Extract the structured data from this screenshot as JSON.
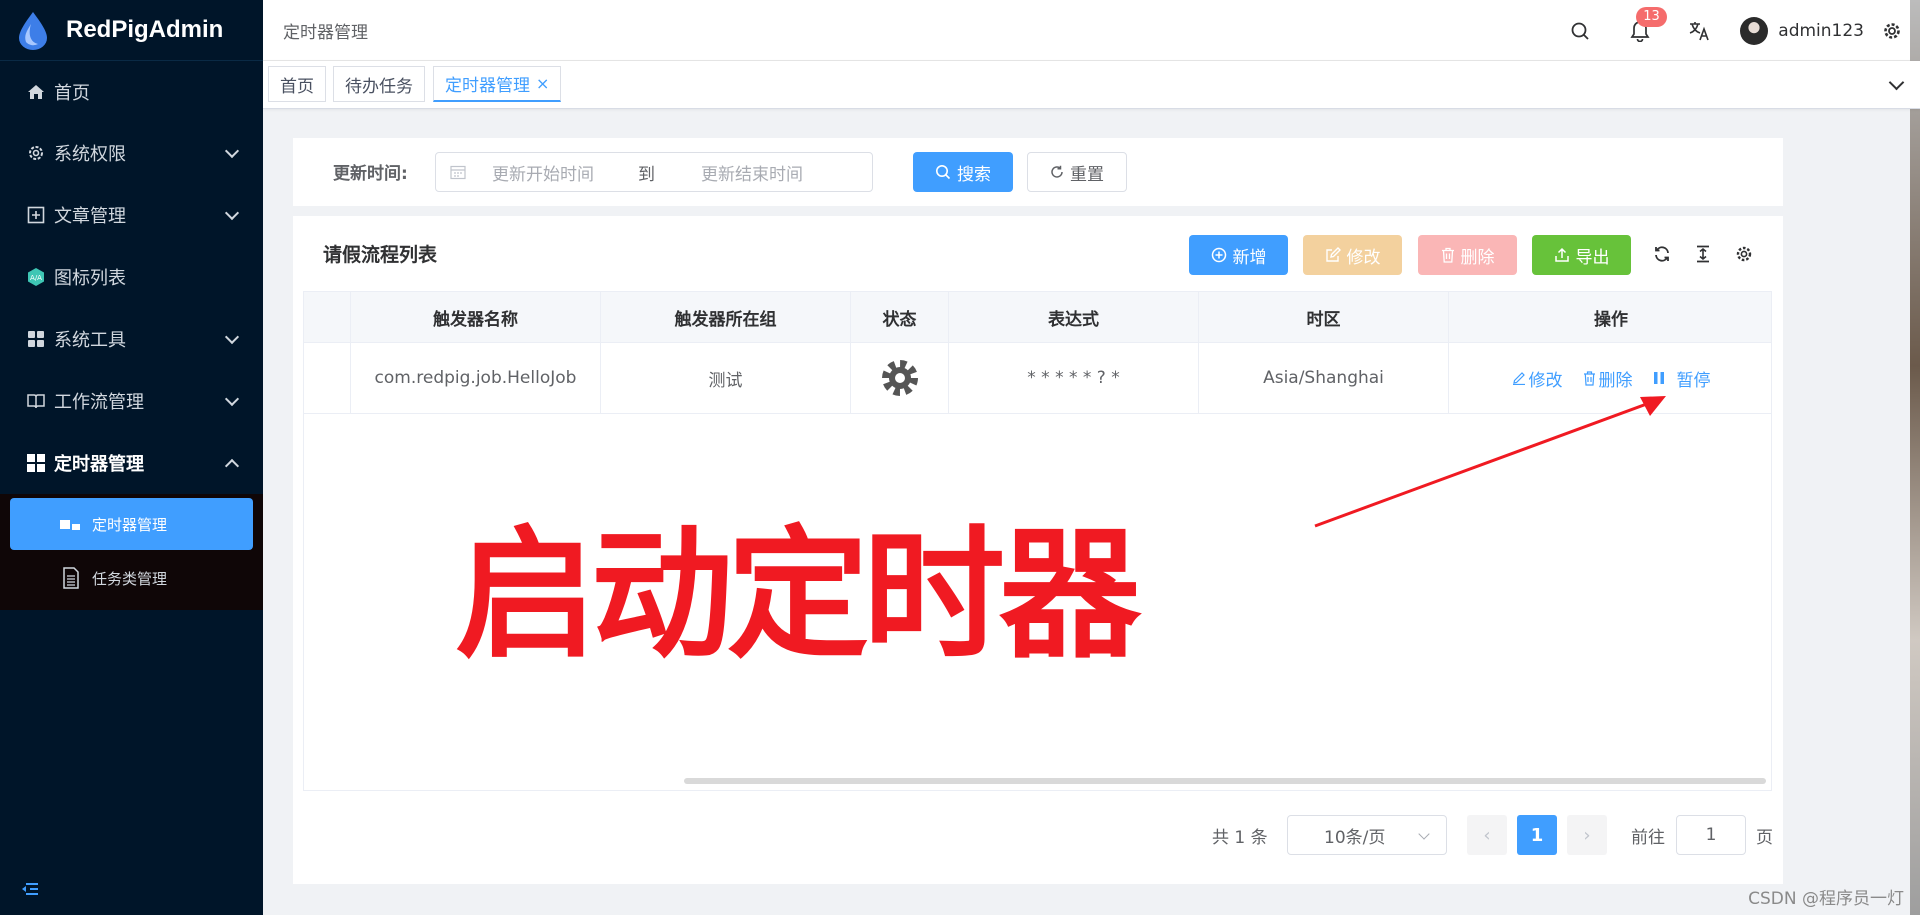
{
  "app": {
    "name": "RedPigAdmin"
  },
  "sidebar": {
    "items": [
      {
        "label": "首页"
      },
      {
        "label": "系统权限"
      },
      {
        "label": "文章管理"
      },
      {
        "label": "图标列表"
      },
      {
        "label": "系统工具"
      },
      {
        "label": "工作流管理"
      },
      {
        "label": "定时器管理"
      }
    ],
    "submenu": [
      {
        "label": "定时器管理"
      },
      {
        "label": "任务类管理"
      }
    ]
  },
  "header": {
    "breadcrumb": "定时器管理",
    "notification_count": "13",
    "username": "admin123"
  },
  "tabs": [
    {
      "label": "首页"
    },
    {
      "label": "待办任务"
    },
    {
      "label": "定时器管理",
      "close": "×"
    }
  ],
  "search": {
    "label": "更新时间:",
    "start_placeholder": "更新开始时间",
    "separator": "到",
    "end_placeholder": "更新结束时间",
    "search_button": "搜索",
    "reset_button": "重置"
  },
  "card": {
    "title": "请假流程列表",
    "add_button": "新增",
    "edit_button": "修改",
    "delete_button": "删除",
    "export_button": "导出"
  },
  "table": {
    "columns": [
      "触发器名称",
      "触发器所在组",
      "状态",
      "表达式",
      "时区",
      "操作"
    ],
    "rows": [
      {
        "name": "com.redpig.job.HelloJob",
        "group": "测试",
        "expression": "* * * * * ? *",
        "timezone": "Asia/Shanghai",
        "actions": [
          "修改",
          "删除",
          "暂停"
        ]
      }
    ]
  },
  "pagination": {
    "total": "共 1 条",
    "page_size": "10条/页",
    "current_page": "1",
    "goto_label": "前往",
    "goto_value": "1",
    "page_suffix": "页"
  },
  "annotation": {
    "text": "启动定时器"
  },
  "watermark": "CSDN @程序员一灯",
  "colors": {
    "primary": "#409eff",
    "sidebar": "#001529",
    "annotation": "#f01a22",
    "success": "#67c23a"
  }
}
